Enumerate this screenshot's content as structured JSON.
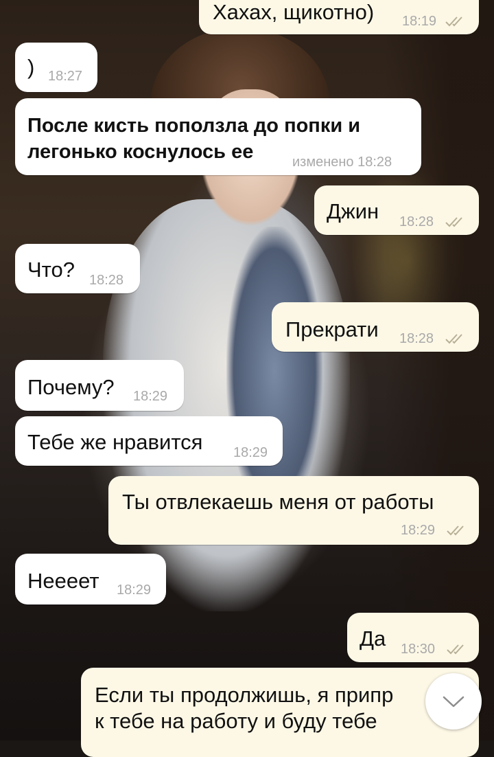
{
  "messages": [
    {
      "dir": "out",
      "text": "Хахах, щикотно)",
      "time": "18:19",
      "read": true
    },
    {
      "dir": "in",
      "text": ")",
      "time": "18:27"
    },
    {
      "dir": "in",
      "text_line1": "После кисть поползла до попки и",
      "text_line2": "легонько коснулось ее",
      "time": "изменено 18:28"
    },
    {
      "dir": "out",
      "text": "Джин",
      "time": "18:28",
      "read": true
    },
    {
      "dir": "in",
      "text": "Что?",
      "time": "18:28"
    },
    {
      "dir": "out",
      "text": "Прекрати",
      "time": "18:28",
      "read": true
    },
    {
      "dir": "in",
      "text": "Почему?",
      "time": "18:29"
    },
    {
      "dir": "in",
      "text": "Тебе же нравится",
      "time": "18:29"
    },
    {
      "dir": "out",
      "text": "Ты отвлекаешь меня от работы",
      "time": "18:29",
      "read": true
    },
    {
      "dir": "in",
      "text": "Нееeет",
      "time": "18:29"
    },
    {
      "dir": "out",
      "text": "Да",
      "time": "18:30",
      "read": true
    },
    {
      "dir": "out",
      "text_line1": "Если ты продолжишь, я припр",
      "text_line2": "к тебе на работу и буду тебе"
    }
  ],
  "icons": {
    "read_receipt": "double-check-icon",
    "scroll_down": "chevron-down-icon"
  },
  "colors": {
    "incoming_bubble": "#ffffff",
    "outgoing_bubble": "#fdf8e6",
    "timestamp": "#a9a9a9",
    "read_check": "#b7b096"
  }
}
